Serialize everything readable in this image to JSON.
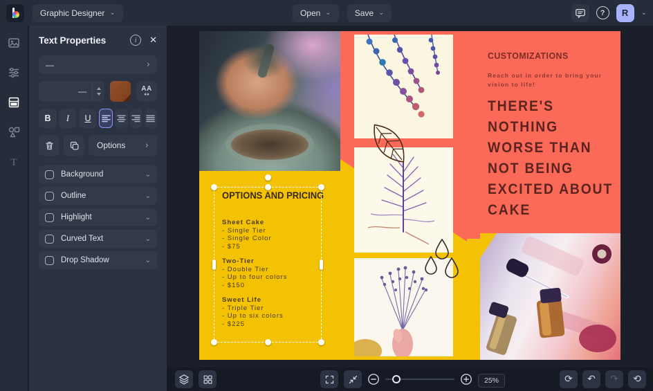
{
  "topbar": {
    "app_title": "Graphic Designer",
    "open_label": "Open",
    "save_label": "Save",
    "avatar_initial": "R"
  },
  "icons": {
    "chevron_down": "⌄",
    "chevron_right": "›",
    "close": "✕",
    "info": "i",
    "question": "?",
    "bold": "B",
    "italic": "I",
    "underline": "U",
    "letter_spacing": "AA",
    "letter_spacing_arrows": "↔",
    "refresh": "⟳",
    "undo": "↶",
    "redo": "↷",
    "history": "⟲"
  },
  "panel": {
    "title": "Text Properties",
    "font_family_value": "—",
    "font_size_value": "—",
    "options_label": "Options",
    "toggles": [
      {
        "label": "Background"
      },
      {
        "label": "Outline"
      },
      {
        "label": "Highlight"
      },
      {
        "label": "Curved Text"
      },
      {
        "label": "Drop Shadow"
      }
    ]
  },
  "canvas": {
    "pricing": {
      "heading": "OPTIONS AND PRICING",
      "groups": [
        {
          "title": "Sheet Cake",
          "lines": [
            "- Single Tier",
            "- Single Color",
            "- $75"
          ]
        },
        {
          "title": "Two-Tier",
          "lines": [
            "- Double Tier",
            "- Up to four colors",
            "- $150"
          ]
        },
        {
          "title": "Sweet Life",
          "lines": [
            "- Triple Tier",
            "- Up to six colors",
            "- $225"
          ]
        }
      ]
    },
    "customizations": {
      "heading": "CUSTOMIZATIONS",
      "subtext": "Reach out in order to bring your vision to life!",
      "statement_lines": [
        "THERE'S",
        "NOTHING",
        "WORSE THAN",
        "NOT BEING",
        "EXCITED ABOUT",
        "CAKE"
      ]
    }
  },
  "bottombar": {
    "zoom_level": "25%"
  },
  "colors": {
    "accent_purple": "#8a93f8",
    "coral": "#fb6a59",
    "yellow": "#f2c203",
    "cream": "#fbf6e2",
    "maroon": "#5c241f",
    "swatch_brown": "#8a4a24"
  }
}
